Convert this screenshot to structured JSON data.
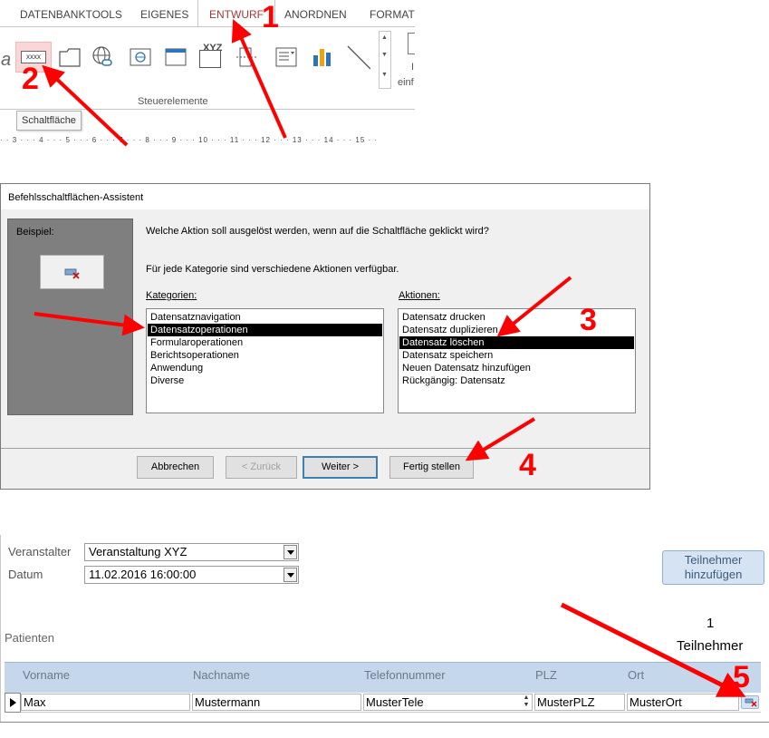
{
  "ribbon": {
    "tabs": [
      {
        "label": "DATENBANKTOOLS"
      },
      {
        "label": "EIGENES"
      },
      {
        "label": "ENTWURF"
      },
      {
        "label": "ANORDNEN"
      },
      {
        "label": "FORMAT"
      }
    ],
    "active_tab": "ENTWURF",
    "button_icon_text": "xxxx",
    "xyz_icon_text": "XYZ",
    "partial_char": "a",
    "right_partial_label": "einf",
    "group_label": "Steuerelemente",
    "tooltip": "Schaltfläche",
    "ruler_text": "· · 3 · · · 4 · · · 5 · · · 6 · · · 7 · · · 8 · · · 9 · · · 10 · · · 11 · · · 12 · · · 13 · · · 14 · · · 15 · ·"
  },
  "wizard": {
    "title": "Befehlsschaltflächen-Assistent",
    "preview_label": "Beispiel:",
    "question": "Welche Aktion soll ausgelöst werden, wenn auf die Schaltfläche geklickt wird?",
    "info": "Für jede Kategorie sind verschiedene Aktionen verfügbar.",
    "categories_label": "Kategorien:",
    "actions_label": "Aktionen:",
    "categories": [
      {
        "label": "Datensatznavigation",
        "selected": false
      },
      {
        "label": "Datensatzoperationen",
        "selected": true
      },
      {
        "label": "Formularoperationen",
        "selected": false
      },
      {
        "label": "Berichtsoperationen",
        "selected": false
      },
      {
        "label": "Anwendung",
        "selected": false
      },
      {
        "label": "Diverse",
        "selected": false
      }
    ],
    "actions": [
      {
        "label": "Datensatz drucken",
        "selected": false
      },
      {
        "label": "Datensatz duplizieren",
        "selected": false
      },
      {
        "label": "Datensatz löschen",
        "selected": true
      },
      {
        "label": "Datensatz speichern",
        "selected": false
      },
      {
        "label": "Neuen Datensatz hinzufügen",
        "selected": false
      },
      {
        "label": "Rückgängig: Datensatz",
        "selected": false
      }
    ],
    "buttons": {
      "cancel": "Abbrechen",
      "back": "< Zurück",
      "next": "Weiter >",
      "finish": "Fertig stellen"
    }
  },
  "form": {
    "organizer_label": "Veranstalter",
    "organizer_value": "Veranstaltung XYZ",
    "date_label": "Datum",
    "date_value": "11.02.2016 16:00:00",
    "add_button": "Teilnehmer hinzufügen",
    "count_value": "1",
    "count_label": "Teilnehmer",
    "subform_label": "Patienten",
    "columns": [
      "Vorname",
      "Nachname",
      "Telefonnummer",
      "PLZ",
      "Ort"
    ],
    "row": [
      "Max",
      "Mustermann",
      "MusterTele",
      "MusterPLZ",
      "MusterOrt"
    ]
  },
  "annotations": [
    "1",
    "2",
    "3",
    "4",
    "5"
  ],
  "colors": {
    "annotation": "#ff0000",
    "active_tab": "#a4373a",
    "grid_header": "#c5d7ea",
    "selection": "#000000"
  }
}
